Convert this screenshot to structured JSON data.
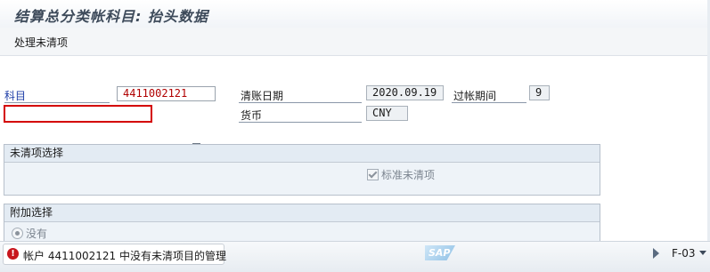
{
  "window": {
    "title": "结算总分类帐科目: 抬头数据"
  },
  "toolbar": {
    "process_open_items": "处理未清项"
  },
  "header_fields": {
    "account_label": "科目",
    "account_value": "4411002121",
    "clearing_date_label": "清账日期",
    "clearing_date_value": "2020.09.19",
    "period_label": "过帐期间",
    "period_value": "9",
    "currency_label": "货币",
    "currency_value": "CNY",
    "company_code_value": ""
  },
  "open_item_selection": {
    "title": "未清项选择",
    "standard_open_items_label": "标准未清项",
    "standard_open_items_checked": true
  },
  "additional_selection": {
    "title": "附加选择",
    "none_label": "没有",
    "none_selected": true
  },
  "statusbar": {
    "message": "帐户 4411002121 中没有未清项目的管理",
    "message_type": "error",
    "logo": "SAP",
    "tcode": "F-03"
  },
  "colors": {
    "error_red": "#c8161d",
    "account_value": "#b00000",
    "label_blue": "#1f3fa8"
  }
}
